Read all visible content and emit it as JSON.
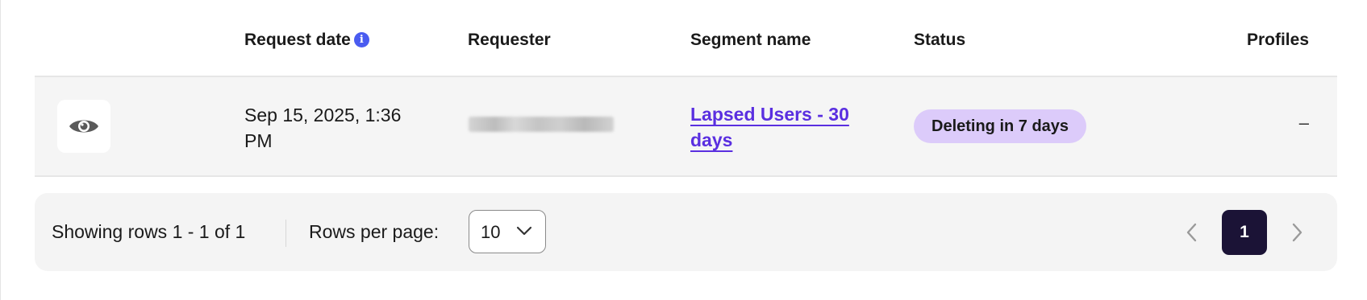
{
  "table": {
    "headers": {
      "request_date": "Request date",
      "requester": "Requester",
      "segment_name": "Segment name",
      "status": "Status",
      "profiles": "Profiles"
    },
    "info_icon": "info-icon",
    "rows": [
      {
        "view_icon": "eye-icon",
        "request_date": "Sep 15, 2025, 1:36 PM",
        "requester": "",
        "segment_name": "Lapsed Users - 30 days",
        "status": "Deleting in 7 days",
        "profiles": "–"
      }
    ]
  },
  "pagination": {
    "showing_text": "Showing rows 1 - 1 of 1",
    "rows_per_page_label": "Rows per page:",
    "rows_per_page_value": "10",
    "current_page": "1",
    "prev_icon": "chevron-left-icon",
    "next_icon": "chevron-right-icon"
  },
  "colors": {
    "link": "#5a2fe0",
    "status_badge_bg": "#dccbfa",
    "info_icon": "#4a5cf0",
    "current_page_bg": "#1b1336",
    "row_bg": "#f5f5f5"
  }
}
